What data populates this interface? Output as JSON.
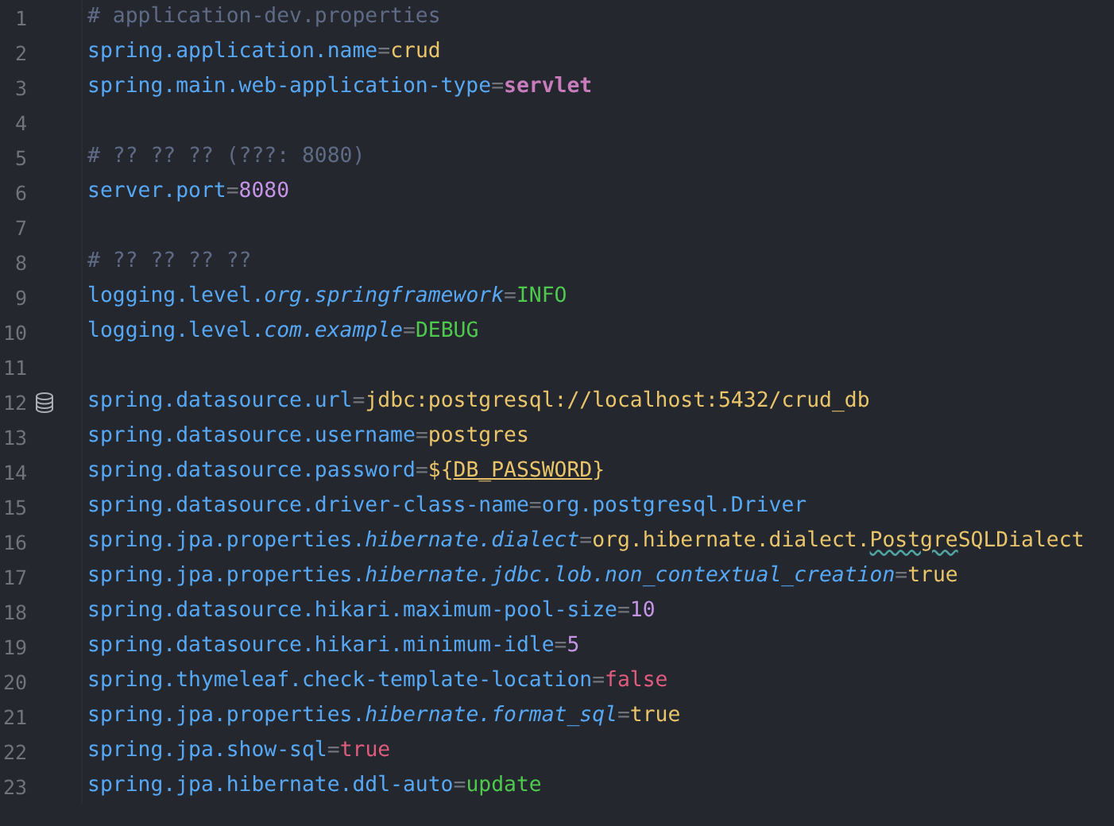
{
  "editor": {
    "lines": [
      {
        "number": "1",
        "kind": "plain",
        "tokens": [
          {
            "kind": "comment",
            "text": "# application-dev.properties"
          }
        ]
      },
      {
        "number": "2",
        "kind": "plain",
        "tokens": [
          {
            "kind": "key",
            "text": "spring.application.name"
          },
          {
            "kind": "op",
            "text": "="
          },
          {
            "kind": "string",
            "text": "crud"
          }
        ]
      },
      {
        "number": "3",
        "kind": "plain",
        "tokens": [
          {
            "kind": "key",
            "text": "spring.main.web-application-type"
          },
          {
            "kind": "op",
            "text": "="
          },
          {
            "kind": "enum",
            "text": "servlet"
          }
        ]
      },
      {
        "number": "4",
        "kind": "plain"
      },
      {
        "number": "5",
        "kind": "plain",
        "tokens": [
          {
            "kind": "comment",
            "text": "# ?? ?? ?? (???: 8080)"
          }
        ]
      },
      {
        "number": "6",
        "kind": "plain",
        "tokens": [
          {
            "kind": "key",
            "text": "server.port"
          },
          {
            "kind": "op",
            "text": "="
          },
          {
            "kind": "number",
            "text": "8080"
          }
        ]
      },
      {
        "number": "7",
        "kind": "plain"
      },
      {
        "number": "8",
        "kind": "plain",
        "tokens": [
          {
            "kind": "comment",
            "text": "# ?? ?? ?? ??"
          }
        ]
      },
      {
        "number": "9",
        "kind": "plain",
        "tokens": [
          {
            "kind": "key",
            "text": "logging.level."
          },
          {
            "kind": "key_italic",
            "text": "org.springframework"
          },
          {
            "kind": "op",
            "text": "="
          },
          {
            "kind": "level",
            "text": "INFO"
          }
        ]
      },
      {
        "number": "10",
        "kind": "plain",
        "tokens": [
          {
            "kind": "key",
            "text": "logging.level."
          },
          {
            "kind": "key_italic",
            "text": "com.example"
          },
          {
            "kind": "op",
            "text": "="
          },
          {
            "kind": "level",
            "text": "DEBUG"
          }
        ]
      },
      {
        "number": "11",
        "kind": "plain"
      },
      {
        "number": "12",
        "kind": "database",
        "tokens": [
          {
            "kind": "key",
            "text": "spring.datasource.url"
          },
          {
            "kind": "op",
            "text": "="
          },
          {
            "kind": "string",
            "text": "jdbc:postgresql://localhost:5432/crud_db"
          }
        ]
      },
      {
        "number": "13",
        "kind": "plain",
        "tokens": [
          {
            "kind": "key",
            "text": "spring.datasource.username"
          },
          {
            "kind": "op",
            "text": "="
          },
          {
            "kind": "string",
            "text": "postgres"
          }
        ]
      },
      {
        "number": "14",
        "kind": "plain",
        "tokens": [
          {
            "kind": "key",
            "text": "spring.datasource.password"
          },
          {
            "kind": "op",
            "text": "="
          },
          {
            "kind": "string",
            "text": "${"
          },
          {
            "kind": "placeholder",
            "text": "DB_PASSWORD"
          },
          {
            "kind": "string",
            "text": "}"
          }
        ]
      },
      {
        "number": "15",
        "kind": "plain",
        "tokens": [
          {
            "kind": "key",
            "text": "spring.datasource.driver-class-name"
          },
          {
            "kind": "op",
            "text": "="
          },
          {
            "kind": "key",
            "text": "org.postgresql.Driver"
          }
        ]
      },
      {
        "number": "16",
        "kind": "plain",
        "tokens": [
          {
            "kind": "key",
            "text": "spring.jpa.properties."
          },
          {
            "kind": "key_italic",
            "text": "hibernate.dialect"
          },
          {
            "kind": "op",
            "text": "="
          },
          {
            "kind": "string",
            "text": "org.hibernate.dialect."
          },
          {
            "kind": "typo",
            "text": "Postgre"
          },
          {
            "kind": "string",
            "text": "SQLDialect"
          }
        ]
      },
      {
        "number": "17",
        "kind": "plain",
        "tokens": [
          {
            "kind": "key",
            "text": "spring.jpa.properties."
          },
          {
            "kind": "key_italic",
            "text": "hibernate.jdbc.lob.non_contextual_creation"
          },
          {
            "kind": "op",
            "text": "="
          },
          {
            "kind": "string",
            "text": "true"
          }
        ]
      },
      {
        "number": "18",
        "kind": "plain",
        "tokens": [
          {
            "kind": "key",
            "text": "spring.datasource.hikari.maximum-pool-size"
          },
          {
            "kind": "op",
            "text": "="
          },
          {
            "kind": "number",
            "text": "10"
          }
        ]
      },
      {
        "number": "19",
        "kind": "plain",
        "tokens": [
          {
            "kind": "key",
            "text": "spring.datasource.hikari.minimum-idle"
          },
          {
            "kind": "op",
            "text": "="
          },
          {
            "kind": "number",
            "text": "5"
          }
        ]
      },
      {
        "number": "20",
        "kind": "plain",
        "tokens": [
          {
            "kind": "key",
            "text": "spring.thymeleaf.check-template-location"
          },
          {
            "kind": "op",
            "text": "="
          },
          {
            "kind": "boolean",
            "text": "false"
          }
        ]
      },
      {
        "number": "21",
        "kind": "plain",
        "tokens": [
          {
            "kind": "key",
            "text": "spring.jpa.properties."
          },
          {
            "kind": "key_italic",
            "text": "hibernate.format_sql"
          },
          {
            "kind": "op",
            "text": "="
          },
          {
            "kind": "string",
            "text": "true"
          }
        ]
      },
      {
        "number": "22",
        "kind": "plain",
        "tokens": [
          {
            "kind": "key",
            "text": "spring.jpa.show-sql"
          },
          {
            "kind": "op",
            "text": "="
          },
          {
            "kind": "boolean",
            "text": "true"
          }
        ]
      },
      {
        "number": "23",
        "kind": "plain",
        "tokens": [
          {
            "kind": "key",
            "text": "spring.jpa.hibernate.ddl-auto"
          },
          {
            "kind": "op",
            "text": "="
          },
          {
            "kind": "level",
            "text": "update"
          }
        ]
      }
    ]
  }
}
